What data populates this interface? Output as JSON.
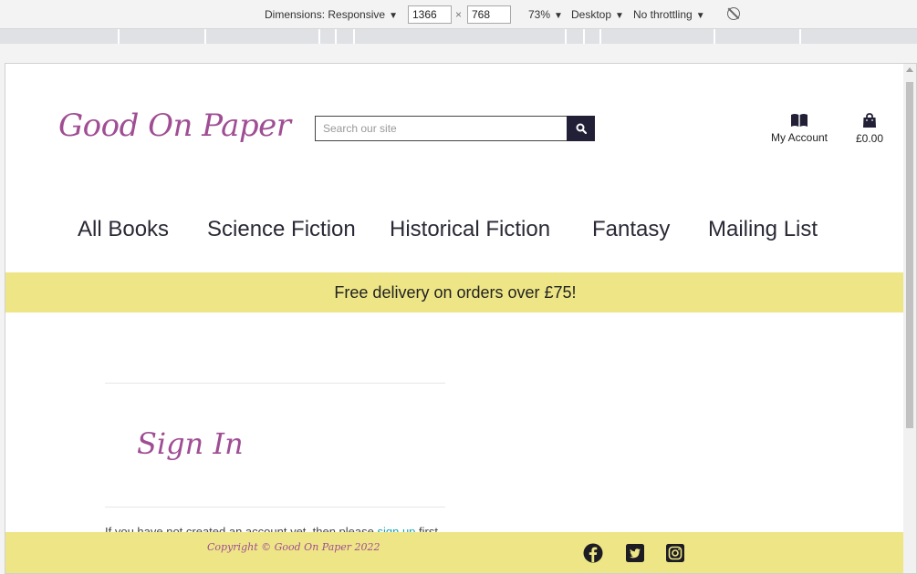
{
  "devtools": {
    "dimensions_label": "Dimensions: Responsive",
    "width_value": "1366",
    "times": "×",
    "height_value": "768",
    "zoom": "73%",
    "device": "Desktop",
    "throttling": "No throttling",
    "caret": "▼"
  },
  "site": {
    "logo": "Good On Paper",
    "search_placeholder": "Search our site",
    "account_label": "My Account",
    "cart_total": "£0.00",
    "nav": [
      "All Books",
      "Science Fiction",
      "Historical Fiction",
      "Fantasy",
      "Mailing List"
    ],
    "banner": "Free delivery on orders over £75!",
    "signin_title": "Sign In",
    "notice_prefix": "If you have not created an account yet, then please ",
    "notice_link": "sign up",
    "notice_suffix": " first.",
    "copyright": "Copyright © Good On Paper 2022",
    "accent_color": "#a04e94",
    "banner_color": "#eee686"
  },
  "icons": {
    "account": "book-icon",
    "cart": "shopping-bag-icon",
    "search": "search-icon",
    "social": [
      "facebook-icon",
      "twitter-icon",
      "instagram-icon"
    ]
  }
}
